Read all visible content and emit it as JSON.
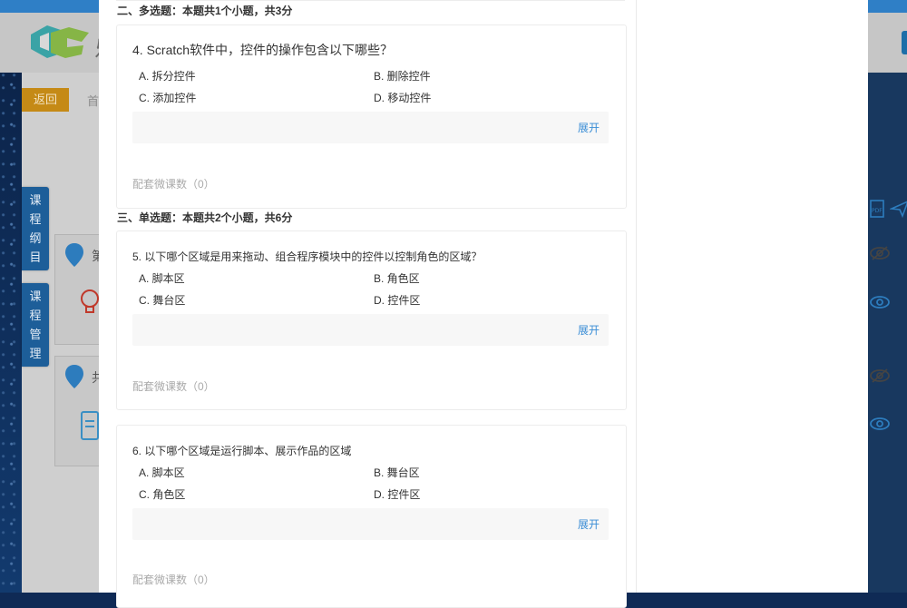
{
  "background": {
    "logo_text": "乐",
    "back_label": "返回",
    "crumb_text": "首",
    "side_tabs": [
      {
        "label": "课程纲目"
      },
      {
        "label": "课程管理"
      }
    ],
    "card_labels": [
      "第",
      "共"
    ]
  },
  "sections": [
    {
      "title": "二、多选题：本题共1个小题，共3分"
    },
    {
      "title": "三、单选题：本题共2个小题，共6分"
    }
  ],
  "questions": [
    {
      "stem": "4. Scratch软件中，控件的操作包含以下哪些？",
      "options": [
        "A. 拆分控件",
        "B. 删除控件",
        "C. 添加控件",
        "D. 移动控件"
      ],
      "expand_label": "展开",
      "micro_label": "配套微课数（0）"
    },
    {
      "stem": "5. 以下哪个区域是用来拖动、组合程序模块中的控件以控制角色的区域？",
      "options": [
        "A. 脚本区",
        "B. 角色区",
        "C. 舞台区",
        "D. 控件区"
      ],
      "expand_label": "展开",
      "micro_label": "配套微课数（0）"
    },
    {
      "stem": "6. 以下哪个区域是运行脚本、展示作品的区域",
      "options": [
        "A. 脚本区",
        "B. 舞台区",
        "C. 角色区",
        "D. 控件区"
      ],
      "expand_label": "展开",
      "micro_label": "配套微课数（0）"
    }
  ]
}
